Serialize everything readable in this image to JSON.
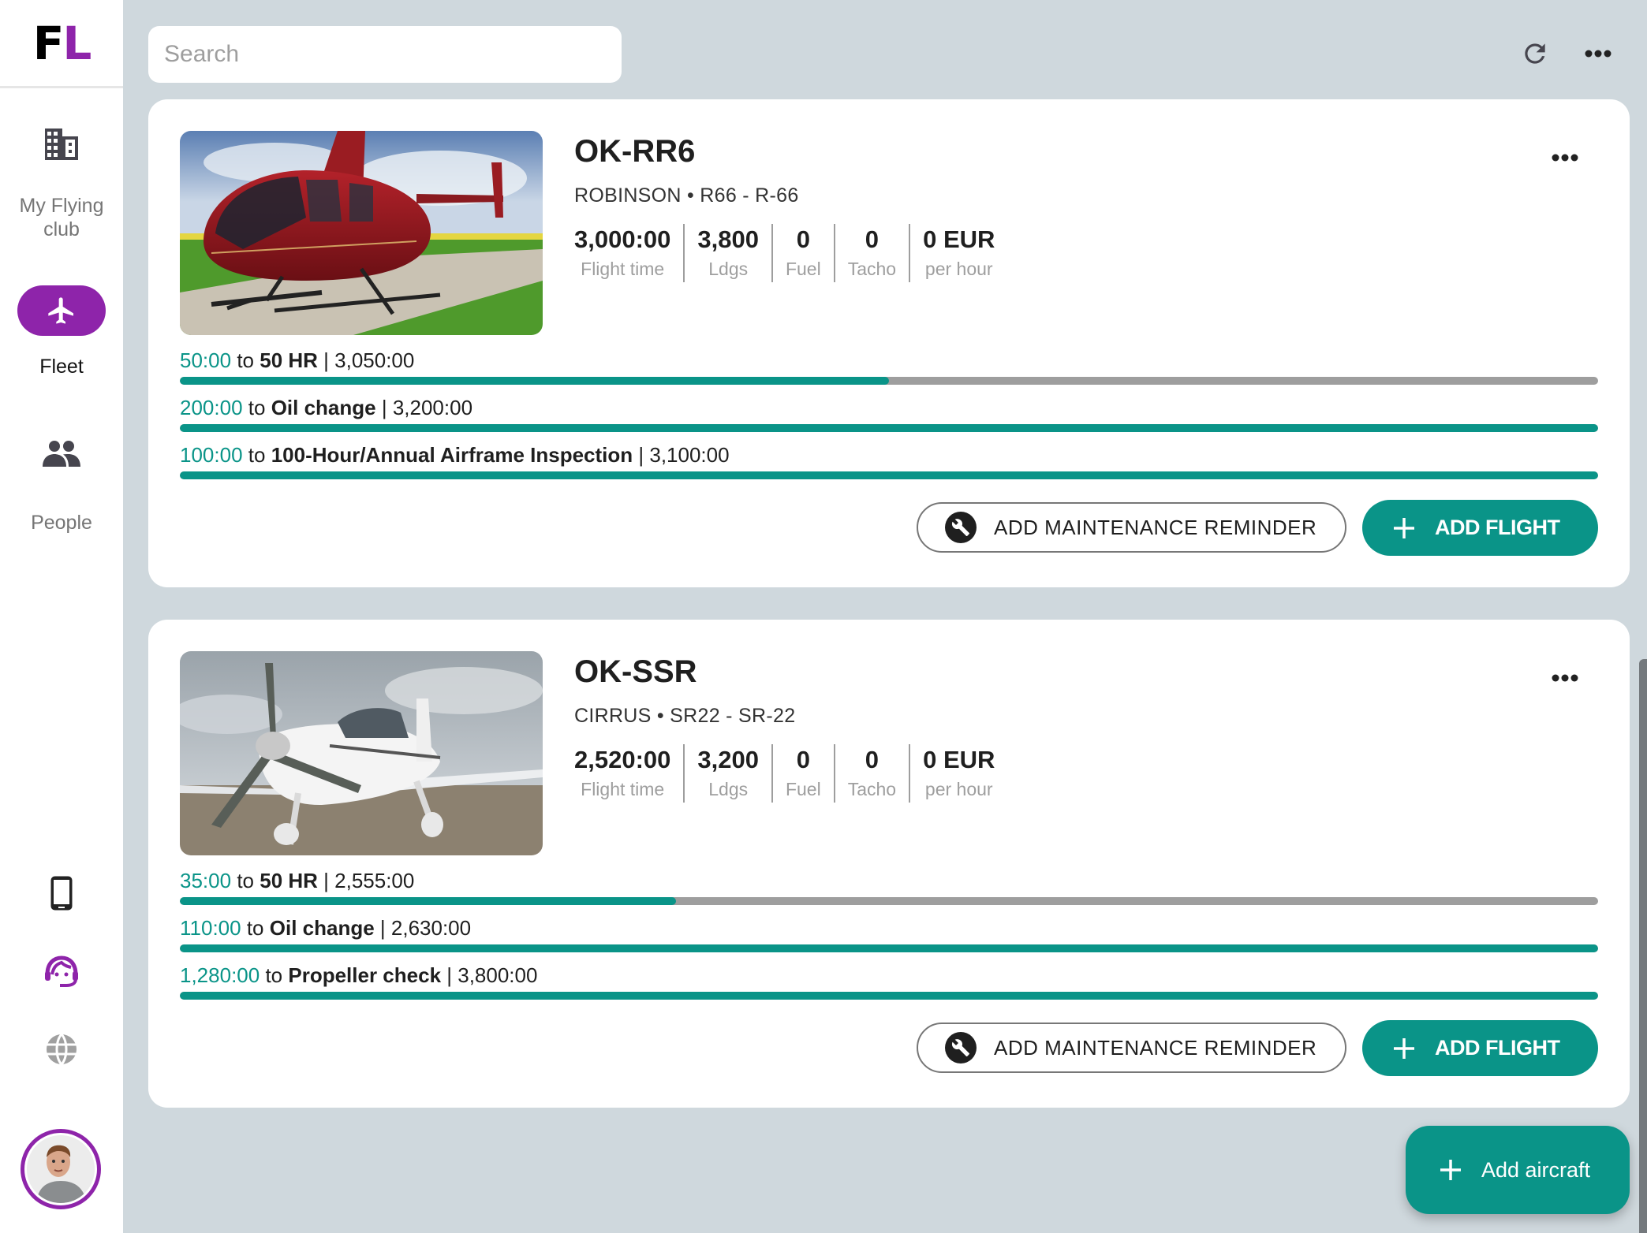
{
  "app": {
    "logo": {
      "first": "F",
      "second": "L"
    },
    "brand_color": "#8e24aa",
    "accent_color": "#0a9488"
  },
  "sidebar": {
    "items": [
      {
        "label": "My Flying club",
        "icon": "building-icon",
        "active": false
      },
      {
        "label": "Fleet",
        "icon": "airplane-icon",
        "active": true
      },
      {
        "label": "People",
        "icon": "people-icon",
        "active": false
      }
    ],
    "bottom_icons": [
      "phone-icon",
      "support-headset-icon",
      "globe-icon"
    ],
    "avatar": "user-avatar"
  },
  "toolbar": {
    "search_placeholder": "Search",
    "search_value": "",
    "refresh_icon": "refresh-icon",
    "more_icon": "more-horizontal-icon"
  },
  "aircraft": [
    {
      "registration": "OK-RR6",
      "model": "ROBINSON • R66 - R-66",
      "image": "helicopter-photo",
      "stats": [
        {
          "value": "3,000:00",
          "label": "Flight time"
        },
        {
          "value": "3,800",
          "label": "Ldgs"
        },
        {
          "value": "0",
          "label": "Fuel"
        },
        {
          "value": "0",
          "label": "Tacho"
        },
        {
          "value": "0 EUR",
          "label": "per hour"
        }
      ],
      "maintenance": [
        {
          "remaining": "50:00",
          "to": "to",
          "name": "50 HR",
          "due": "| 3,050:00",
          "progress": 0.5
        },
        {
          "remaining": "200:00",
          "to": "to",
          "name": "Oil change",
          "due": "| 3,200:00",
          "progress": 1.0
        },
        {
          "remaining": "100:00",
          "to": "to",
          "name": "100-Hour/Annual Airframe Inspection",
          "due": "| 3,100:00",
          "progress": 1.0
        }
      ],
      "add_reminder_label": "ADD MAINTENANCE REMINDER",
      "add_flight_label": "ADD FLIGHT"
    },
    {
      "registration": "OK-SSR",
      "model": "CIRRUS • SR22 - SR-22",
      "image": "airplane-photo",
      "stats": [
        {
          "value": "2,520:00",
          "label": "Flight time"
        },
        {
          "value": "3,200",
          "label": "Ldgs"
        },
        {
          "value": "0",
          "label": "Fuel"
        },
        {
          "value": "0",
          "label": "Tacho"
        },
        {
          "value": "0 EUR",
          "label": "per hour"
        }
      ],
      "maintenance": [
        {
          "remaining": "35:00",
          "to": "to",
          "name": "50 HR",
          "due": "| 2,555:00",
          "progress": 0.35
        },
        {
          "remaining": "110:00",
          "to": "to",
          "name": "Oil change",
          "due": "| 2,630:00",
          "progress": 1.0
        },
        {
          "remaining": "1,280:00",
          "to": "to",
          "name": "Propeller check",
          "due": "| 3,800:00",
          "progress": 1.0
        }
      ],
      "add_reminder_label": "ADD MAINTENANCE REMINDER",
      "add_flight_label": "ADD FLIGHT"
    }
  ],
  "fab": {
    "label": "Add aircraft"
  }
}
